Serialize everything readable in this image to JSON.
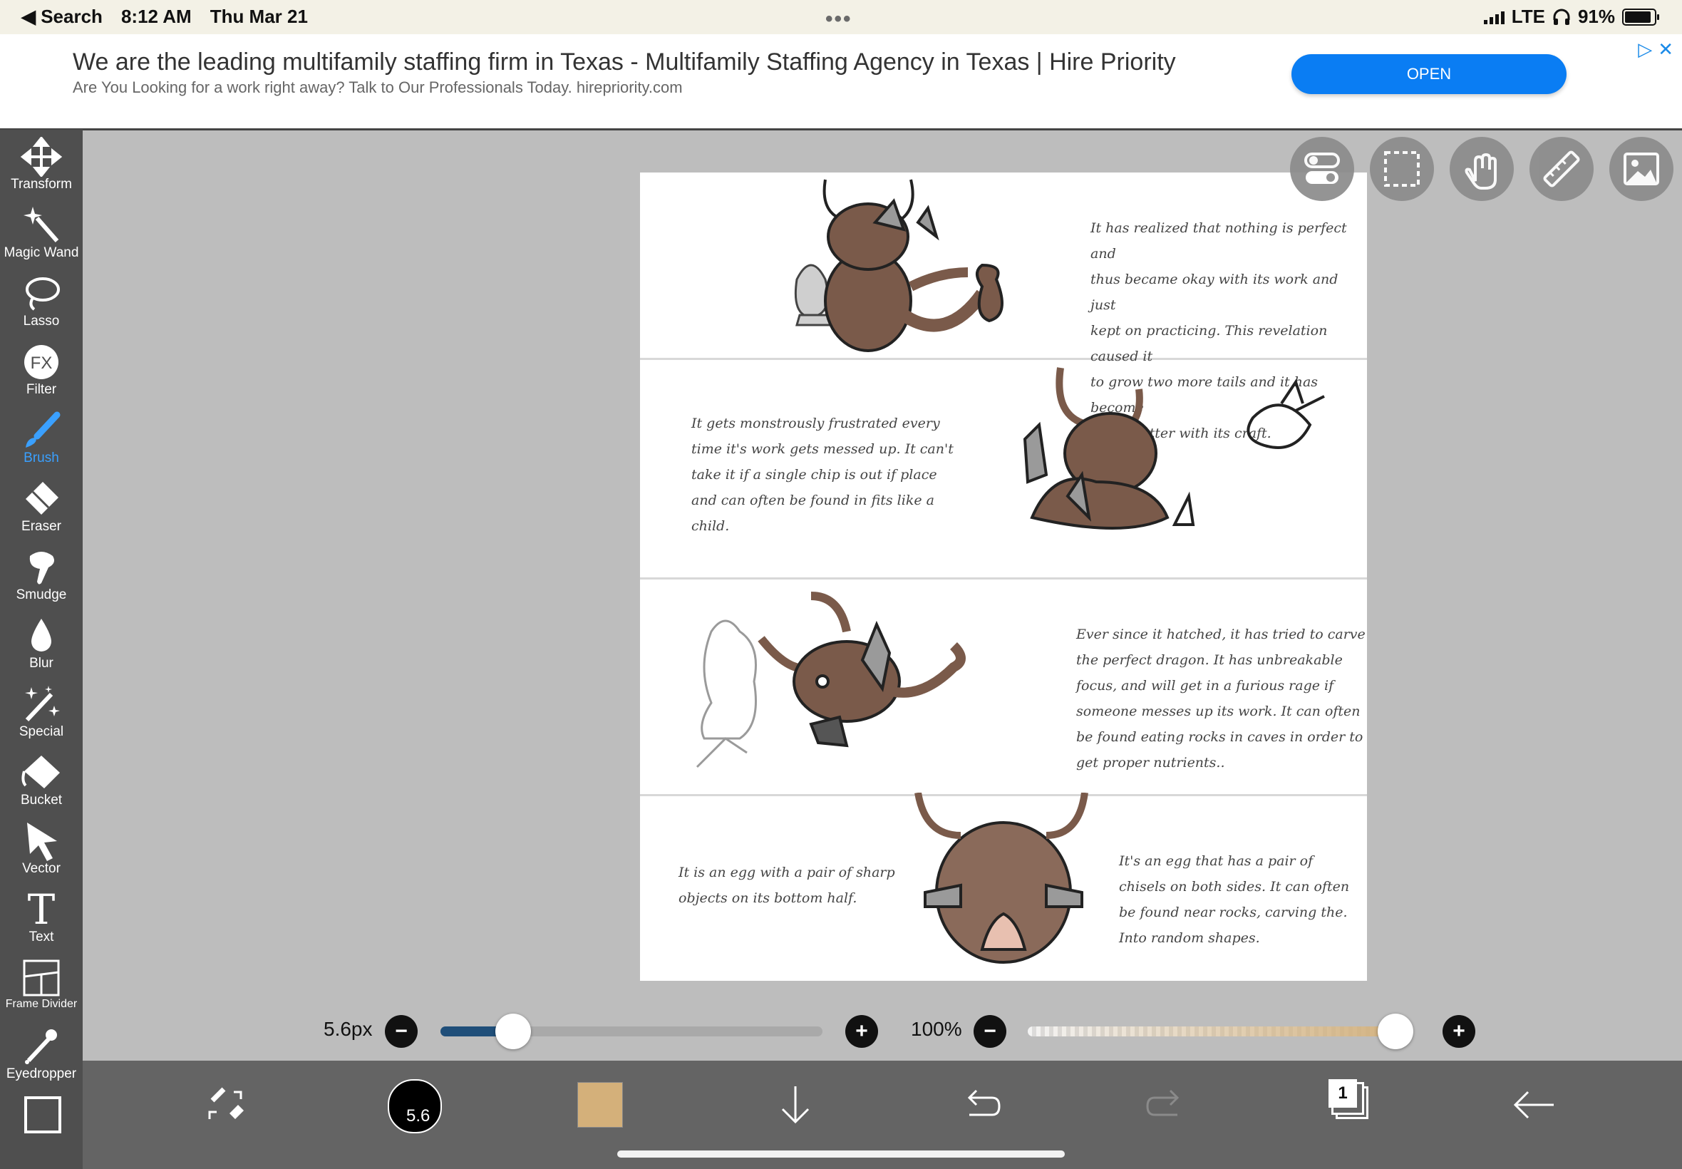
{
  "status_bar": {
    "back_label": "◀ Search",
    "time": "8:12 AM",
    "date": "Thu Mar 21",
    "dots": "•••",
    "network": "LTE",
    "battery": "91%"
  },
  "ad": {
    "headline": "We are the leading multifamily staffing firm in Texas - Multifamily Staffing Agency in Texas | Hire Priority",
    "subtext": "Are You Looking for a work right away? Talk to Our Professionals Today. hirepriority.com",
    "button_label": "OPEN",
    "adchoice_icon": "▷",
    "close_icon": "✕"
  },
  "tools": [
    {
      "name": "transform",
      "label": "Transform",
      "icon": "move-icon"
    },
    {
      "name": "magic-wand",
      "label": "Magic Wand",
      "icon": "magic-wand-icon"
    },
    {
      "name": "lasso",
      "label": "Lasso",
      "icon": "lasso-icon"
    },
    {
      "name": "filter",
      "label": "Filter",
      "icon": "fx-icon",
      "icon_text": "FX"
    },
    {
      "name": "brush",
      "label": "Brush",
      "icon": "brush-icon",
      "active": true
    },
    {
      "name": "eraser",
      "label": "Eraser",
      "icon": "eraser-icon"
    },
    {
      "name": "smudge",
      "label": "Smudge",
      "icon": "smudge-icon"
    },
    {
      "name": "blur",
      "label": "Blur",
      "icon": "droplet-icon"
    },
    {
      "name": "special",
      "label": "Special",
      "icon": "sparkle-wand-icon"
    },
    {
      "name": "bucket",
      "label": "Bucket",
      "icon": "bucket-icon"
    },
    {
      "name": "vector",
      "label": "Vector",
      "icon": "cursor-arrow-icon"
    },
    {
      "name": "text",
      "label": "Text",
      "icon": "text-icon",
      "icon_text": "T"
    },
    {
      "name": "frame-divider",
      "label": "Frame Divider",
      "icon": "frame-divider-icon"
    },
    {
      "name": "eyedropper",
      "label": "Eyedropper",
      "icon": "eyedropper-icon"
    }
  ],
  "canvas": {
    "panel1_text": "It has realized that nothing is perfect and\nthus became okay with its work and just\nkept on practicing. This revelation caused it\nto grow two more tails and it has become\nmuch better with its craft.",
    "panel2_text": "It gets monstrously frustrated every\ntime it's work gets messed up. It can't\ntake it if a single chip is out if place\nand can often be found in fits like a\nchild.",
    "panel3_text": "Ever since it hatched, it has tried to carve\nthe perfect dragon. It has unbreakable\nfocus, and will get in a furious rage if\nsomeone messes up its work. It can often\nbe found eating rocks in caves in order to\nget proper nutrients..",
    "panel4_left_text": "It is an egg with a pair of sharp\nobjects on its bottom half.",
    "panel4_right_text": "It's an egg that has a pair of\nchisels on both sides. It can often\nbe found near rocks, carving the.\nInto random shapes."
  },
  "top_buttons": [
    "toggle-icon",
    "selection-icon",
    "hand-touch-icon",
    "ruler-icon",
    "image-icon"
  ],
  "brush_size": {
    "label": "5.6px",
    "value": 0.19
  },
  "opacity": {
    "label": "100%",
    "value": 1.0
  },
  "bottom_bar": {
    "brush_size_badge": "5.6",
    "color_swatch": "#d4b07a",
    "layer_count": "1",
    "icons": [
      "swap-tools-icon",
      "brush-size-icon",
      "color-swatch",
      "download-icon",
      "undo-icon",
      "redo-icon",
      "layers-icon",
      "back-arrow-icon"
    ]
  },
  "colors": {
    "accent": "#3aa0ff",
    "ad_button": "#0a7df3",
    "slider_fill": "#1f4e79",
    "opacity_fill": "#d2b07c"
  }
}
